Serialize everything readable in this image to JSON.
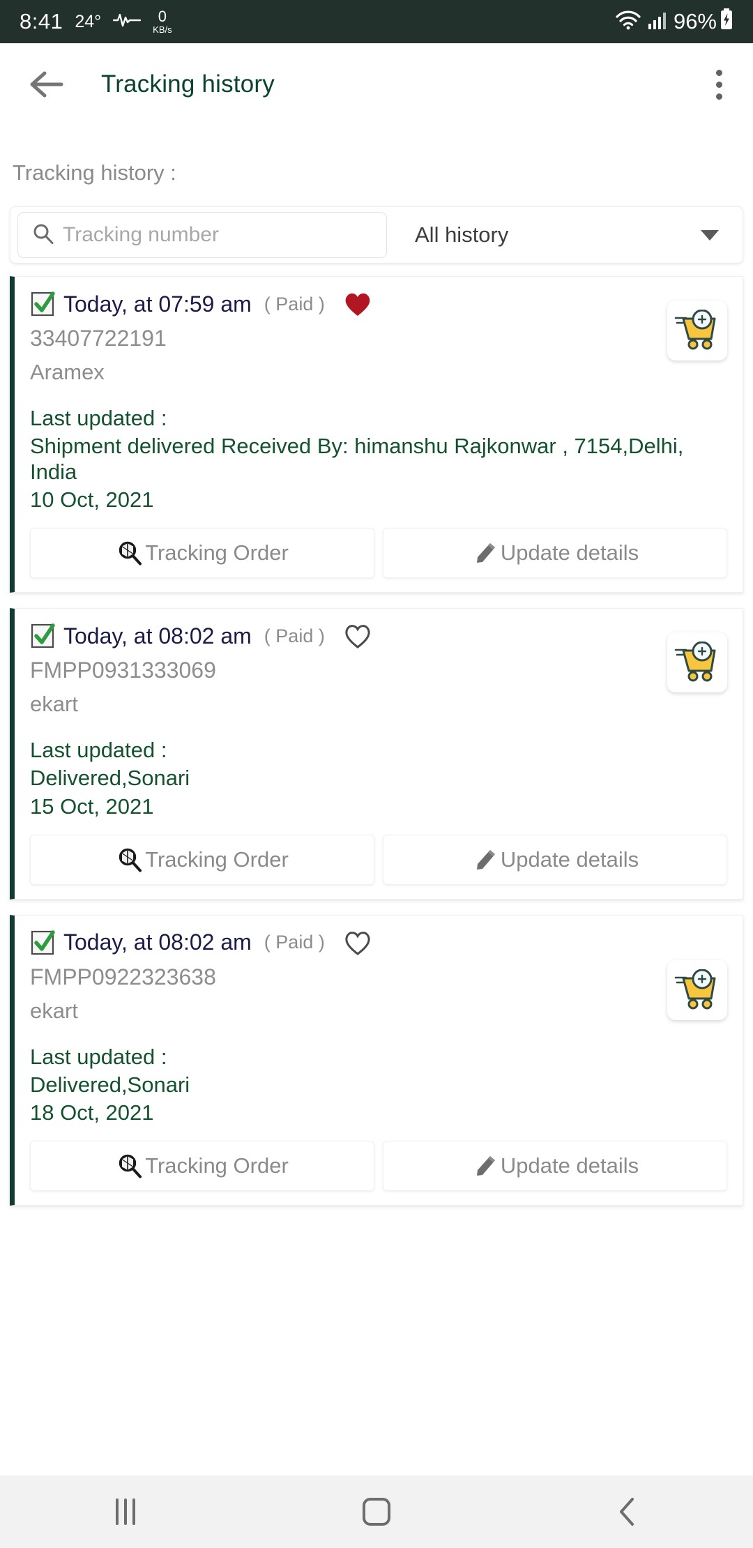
{
  "status_bar": {
    "time": "8:41",
    "temperature": "24°",
    "net_icon": "network-activity-icon",
    "net_rate_value": "0",
    "net_rate_unit": "KB/s",
    "wifi_icon": "wifi-icon",
    "signal_icon": "cellular-signal-icon",
    "battery": "96%",
    "battery_icon": "battery-charging-icon"
  },
  "app_bar": {
    "back_icon": "back-arrow-icon",
    "title": "Tracking history",
    "overflow_icon": "overflow-menu-icon"
  },
  "section": {
    "label": "Tracking history :"
  },
  "search": {
    "icon": "search-icon",
    "placeholder": "Tracking number",
    "value": ""
  },
  "history_filter": {
    "selected": "All history",
    "caret_icon": "chevron-down-icon"
  },
  "buttons": {
    "tracking_order": "Tracking Order",
    "tracking_order_icon": "package-search-icon",
    "update_details": "Update details",
    "update_details_icon": "pencil-icon"
  },
  "colors": {
    "status_bar_bg": "#22312c",
    "title_green": "#0b4332",
    "status_green": "#14522f",
    "card_stripe": "#123c33",
    "muted_gray": "#8d8d8d",
    "time_navy": "#1b1b47",
    "heart_filled": "#b01722",
    "cart_yellow": "#f8c53f"
  },
  "cards": [
    {
      "check_icon": "checkbox-checked-icon",
      "time": "Today, at 07:59 am",
      "paid": "( Paid )",
      "favorite": true,
      "favorite_icon": "heart-filled-icon",
      "tracking_number": "33407722191",
      "carrier": "Aramex",
      "last_updated_label": "Last updated :",
      "status": "Shipment delivered   Received By: himanshu Rajkonwar , 7154,Delhi, India",
      "date": "10 Oct, 2021",
      "thumb_icon": "shopping-cart-icon"
    },
    {
      "check_icon": "checkbox-checked-icon",
      "time": "Today, at 08:02 am",
      "paid": "( Paid )",
      "favorite": false,
      "favorite_icon": "heart-outline-icon",
      "tracking_number": "FMPP0931333069",
      "carrier": "ekart",
      "last_updated_label": "Last updated :",
      "status": "Delivered,Sonari",
      "date": "15 Oct, 2021",
      "thumb_icon": "shopping-cart-icon"
    },
    {
      "check_icon": "checkbox-checked-icon",
      "time": "Today, at 08:02 am",
      "paid": "( Paid )",
      "favorite": false,
      "favorite_icon": "heart-outline-icon",
      "tracking_number": "FMPP0922323638",
      "carrier": "ekart",
      "last_updated_label": "Last updated :",
      "status": "Delivered,Sonari",
      "date": "18 Oct, 2021",
      "thumb_icon": "shopping-cart-icon"
    }
  ],
  "nav_bar": {
    "recents_icon": "recents-icon",
    "home_icon": "home-icon",
    "back_icon": "back-icon"
  }
}
